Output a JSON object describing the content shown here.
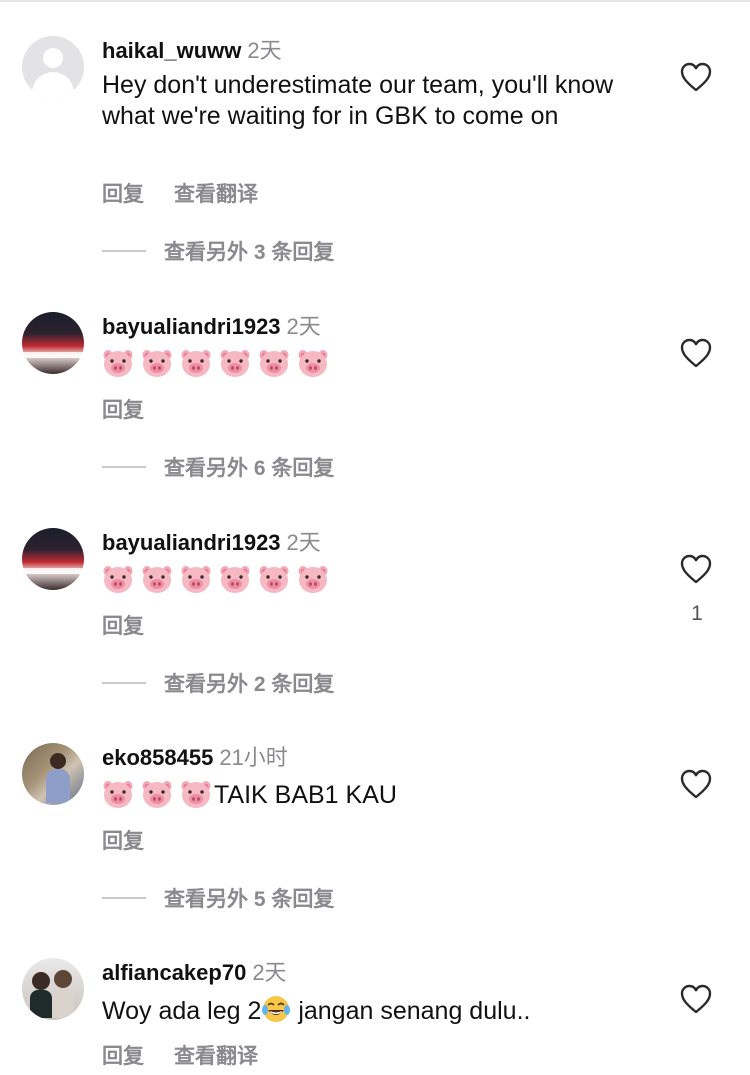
{
  "comments": [
    {
      "username": "haikal_wuww",
      "time": "2天",
      "text": "Hey don't underestimate our team, you'll know what we're waiting for in GBK to come on",
      "reply_label": "回复",
      "translate_label": "查看翻译",
      "view_replies": "查看另外 3 条回复",
      "avatar": "default-avatar"
    },
    {
      "username": "bayualiandri1923",
      "time": "2天",
      "emoji": [
        "pig-face",
        "pig-face",
        "pig-face",
        "pig-face",
        "pig-face",
        "pig-face"
      ],
      "reply_label": "回复",
      "view_replies": "查看另外 6 条回复",
      "avatar": "crowd-photo"
    },
    {
      "username": "bayualiandri1923",
      "time": "2天",
      "emoji": [
        "pig-face",
        "pig-face",
        "pig-face",
        "pig-face",
        "pig-face",
        "pig-face"
      ],
      "reply_label": "回复",
      "likes": "1",
      "view_replies": "查看另外 2 条回复",
      "avatar": "crowd-photo"
    },
    {
      "username": "eko858455",
      "time": "21小时",
      "emoji": [
        "pig-face",
        "pig-face",
        "pig-face"
      ],
      "text": "TAIK BAB1 KAU",
      "reply_label": "回复",
      "view_replies": "查看另外 5 条回复",
      "avatar": "child-photo"
    },
    {
      "username": "alfiancakep70",
      "time": "2天",
      "text_before": "Woy ada leg 2",
      "text_emoji": "laughing-tears",
      "text_after": " jangan senang dulu..",
      "reply_label": "回复",
      "translate_label": "查看翻译",
      "avatar": "dolls-photo"
    }
  ],
  "colors": {
    "text": "#111111",
    "muted": "#8a8a8e",
    "divider": "#c9c9cc"
  }
}
